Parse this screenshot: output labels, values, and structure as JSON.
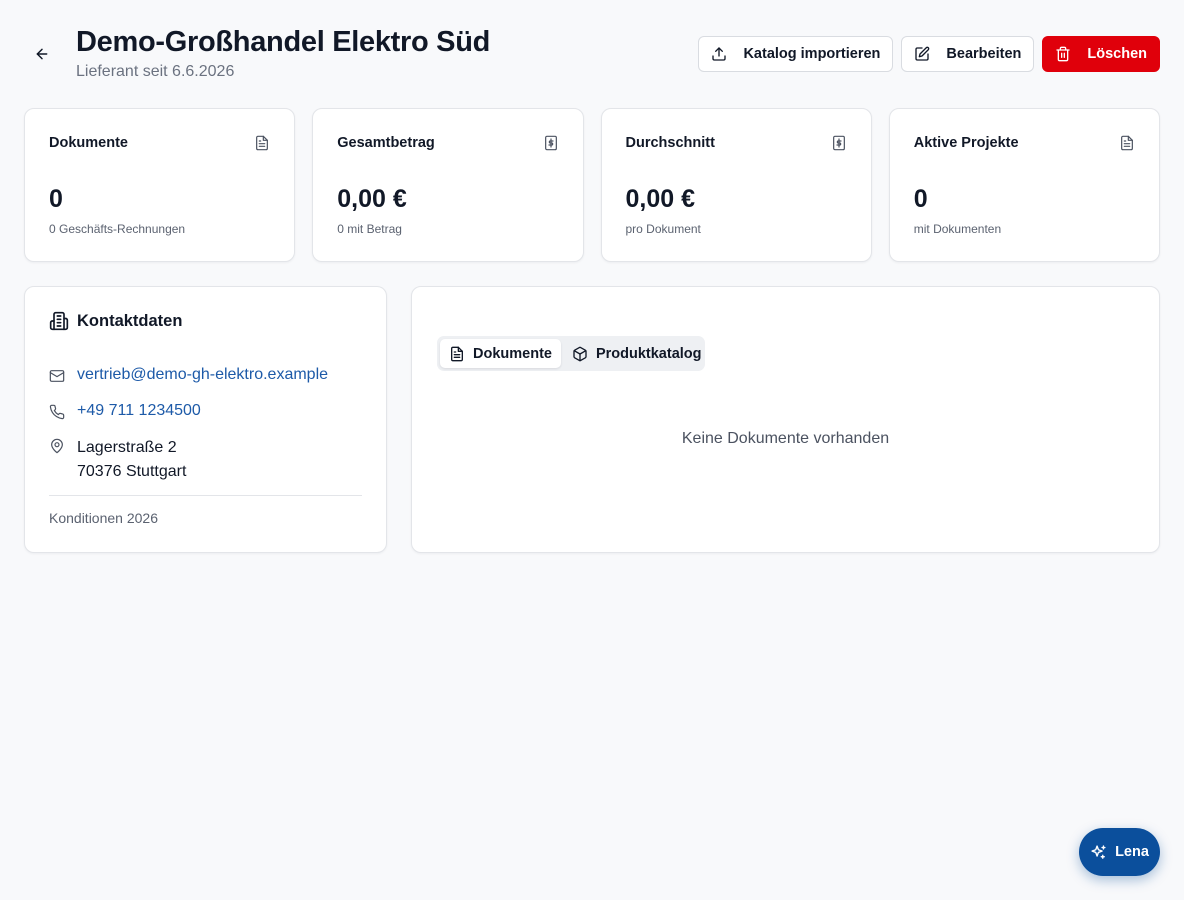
{
  "header": {
    "title": "Demo-Großhandel Elektro Süd",
    "subtitle": "Lieferant seit 6.6.2026",
    "back_icon": "arrow-left-icon"
  },
  "actions": {
    "import_label": "Katalog importieren",
    "edit_label": "Bearbeiten",
    "delete_label": "Löschen"
  },
  "stats": [
    {
      "label": "Dokumente",
      "value": "0",
      "sub": "0 Geschäfts-Rechnungen",
      "icon": "file-icon"
    },
    {
      "label": "Gesamtbetrag",
      "value": "0,00 €",
      "sub": "0 mit Betrag",
      "icon": "dollar-file-icon"
    },
    {
      "label": "Durchschnitt",
      "value": "0,00 €",
      "sub": "pro Dokument",
      "icon": "dollar-file-icon"
    },
    {
      "label": "Aktive Projekte",
      "value": "0",
      "sub": "mit Dokumenten",
      "icon": "file-icon"
    }
  ],
  "contact": {
    "title": "Kontaktdaten",
    "email": "vertrieb@demo-gh-elektro.example",
    "phone": "+49 711 1234500",
    "street": "Lagerstraße 2",
    "city": "70376 Stuttgart",
    "conditions": "Konditionen 2026"
  },
  "tabs": [
    {
      "label": "Dokumente",
      "active": true
    },
    {
      "label": "Produktkatalog",
      "active": false
    }
  ],
  "empty_state": "Keine Dokumente vorhanden",
  "fab": {
    "label": "Lena"
  },
  "colors": {
    "danger": "#e0000b",
    "link": "#1d5aa8",
    "fab": "#0b4f9c"
  }
}
